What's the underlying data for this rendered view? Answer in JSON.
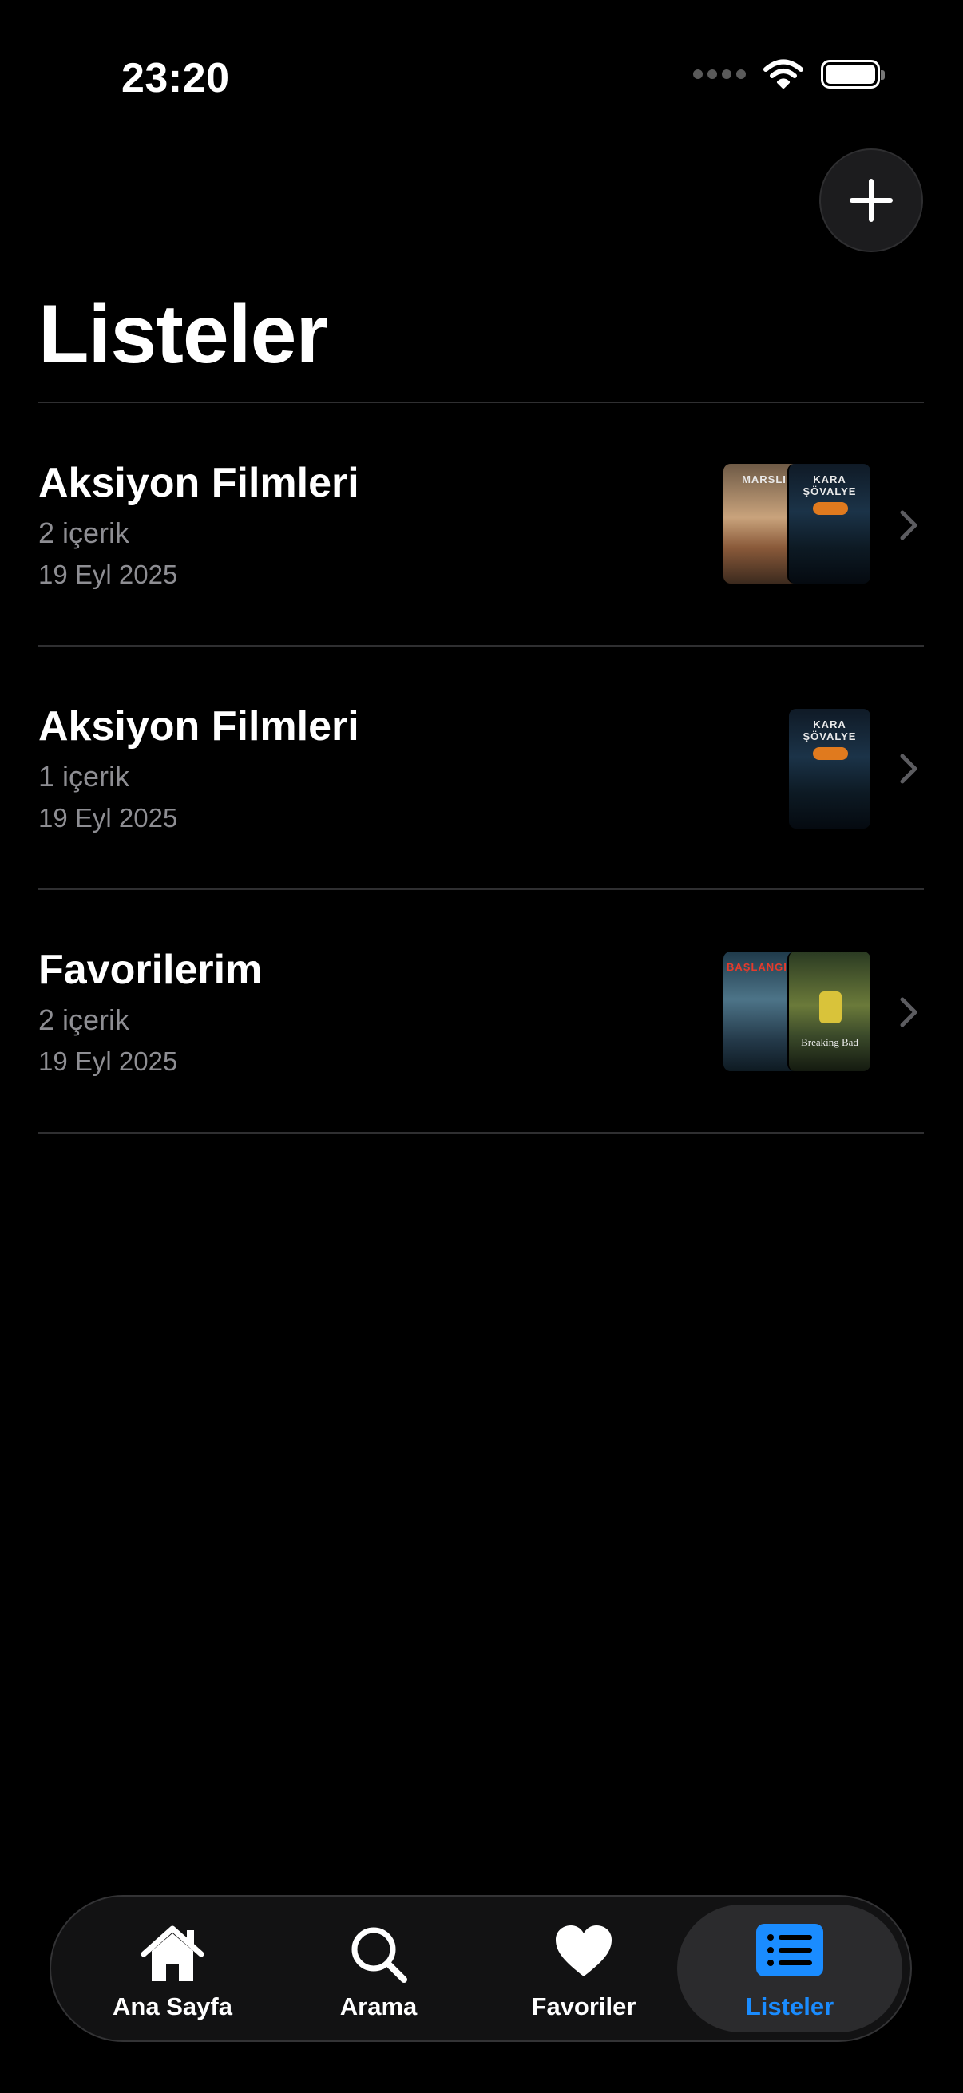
{
  "status": {
    "time": "23:20"
  },
  "header": {
    "title": "Listeler"
  },
  "lists": [
    {
      "title": "Aksiyon Filmleri",
      "count": "2 içerik",
      "date": "19 Eyl 2025",
      "posters": [
        "MARSLI",
        "KARA ŞÖVALYE"
      ]
    },
    {
      "title": "Aksiyon Filmleri",
      "count": "1 içerik",
      "date": "19 Eyl 2025",
      "posters": [
        "KARA ŞÖVALYE"
      ]
    },
    {
      "title": "Favorilerim",
      "count": "2 içerik",
      "date": "19 Eyl 2025",
      "posters": [
        "BAŞLANGIÇ",
        "Breaking Bad"
      ]
    }
  ],
  "tabs": [
    {
      "label": "Ana Sayfa",
      "icon": "house-icon"
    },
    {
      "label": "Arama",
      "icon": "search-icon"
    },
    {
      "label": "Favoriler",
      "icon": "heart-icon"
    },
    {
      "label": "Listeler",
      "icon": "list-icon",
      "active": true
    }
  ],
  "colors": {
    "accent": "#1a8cff",
    "background": "#000000",
    "secondary_text": "#8e8e93"
  }
}
